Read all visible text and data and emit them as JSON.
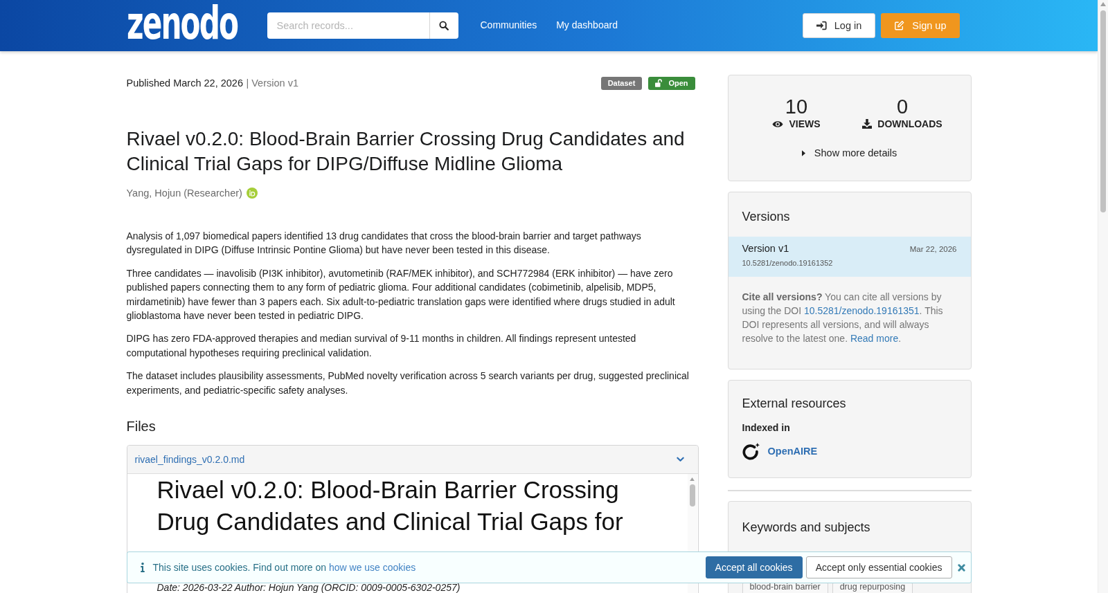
{
  "header": {
    "logo": "zenodo",
    "search": {
      "placeholder": "Search records..."
    },
    "nav": [
      {
        "label": "Communities"
      },
      {
        "label": "My dashboard"
      }
    ],
    "actions": [
      {
        "label": "Log in",
        "kind": "login"
      },
      {
        "label": "Sign up",
        "kind": "signup"
      }
    ]
  },
  "record": {
    "published": "Published March 22, 2026",
    "version": "| Version v1",
    "badges": [
      {
        "label": "Dataset",
        "kind": "resource_type"
      },
      {
        "label": "Open",
        "kind": "access"
      }
    ],
    "title": "Rivael v0.2.0: Blood-Brain Barrier Crossing Drug Candidates and Clinical Trial Gaps for DIPG/Diffuse Midline Glioma",
    "creators": [
      {
        "name": "Yang, Hojun (Researcher)",
        "orcid": true
      }
    ],
    "description": [
      "Analysis of 1,097 biomedical papers identified 13 drug candidates that cross the blood-brain barrier and target pathways dysregulated in DIPG (Diffuse Intrinsic Pontine Glioma) but have never been tested in this disease.",
      "Three candidates — inavolisib (PI3K inhibitor), avutometinib (RAF/MEK inhibitor), and SCH772984 (ERK inhibitor) — have zero published papers connecting them to any form of pediatric glioma. Four additional candidates (cobimetinib, alpelisib, MDP5, mirdametinib) have fewer than 3 papers each. Six adult-to-pediatric translation gaps were identified where drugs studied in adult glioblastoma have never been tested in pediatric DIPG.",
      "DIPG has zero FDA-approved therapies and median survival of 9-11 months in children. All findings represent untested computational hypotheses requiring preclinical validation.",
      "The dataset includes plausibility assessments, PubMed novelty verification across 5 search variants per drug, suggested preclinical experiments, and pediatric-specific safety analyses."
    ]
  },
  "files": {
    "heading": "Files",
    "items": [
      {
        "name": "rivael_findings_v0.2.0.md",
        "expanded": true,
        "preview": {
          "heading": "Rivael v0.2.0: Blood-Brain Barrier Crossing Drug Candidates and Clinical Trial Gaps for",
          "meta": "Date: 2026-03-22 Author: Hojun Yang (ORCID: 0009-0005-6302-0257)"
        }
      }
    ]
  },
  "stats": {
    "items": [
      {
        "value": "10",
        "label": "VIEWS",
        "kind": "views"
      },
      {
        "value": "0",
        "label": "DOWNLOADS",
        "kind": "downloads"
      }
    ],
    "details": {
      "label": "Show more details",
      "expanded": false
    }
  },
  "versions": {
    "heading": "Versions",
    "items": [
      {
        "label": "Version v1",
        "date": "Mar 22, 2026",
        "doi": "10.5281/zenodo.19161352",
        "selected": true
      }
    ],
    "cite": [
      {
        "kind": "bold",
        "text": "Cite all versions?"
      },
      {
        "kind": "text",
        "text": " You can cite all versions by using the DOI "
      },
      {
        "kind": "link",
        "text": "10.5281/zenodo.19161351"
      },
      {
        "kind": "text",
        "text": ". This DOI represents all versions, and will always resolve to the latest one. "
      },
      {
        "kind": "link",
        "text": "Read more"
      },
      {
        "kind": "text",
        "text": "."
      }
    ]
  },
  "external_resources": {
    "heading": "External resources",
    "subheading": "Indexed in",
    "links": [
      {
        "label": "OpenAIRE"
      }
    ]
  },
  "keywords": {
    "heading": "Keywords and subjects",
    "tags": [
      "blood-brain barrier",
      "drug repurposing"
    ]
  },
  "cookie_banner": {
    "parts": [
      {
        "kind": "text",
        "text": "This site uses cookies. Find out more on "
      },
      {
        "kind": "link",
        "text": "how we use cookies"
      }
    ],
    "buttons": [
      {
        "label": "Accept all cookies",
        "kind": "primary"
      },
      {
        "label": "Accept only essential cookies",
        "kind": "secondary"
      }
    ]
  }
}
